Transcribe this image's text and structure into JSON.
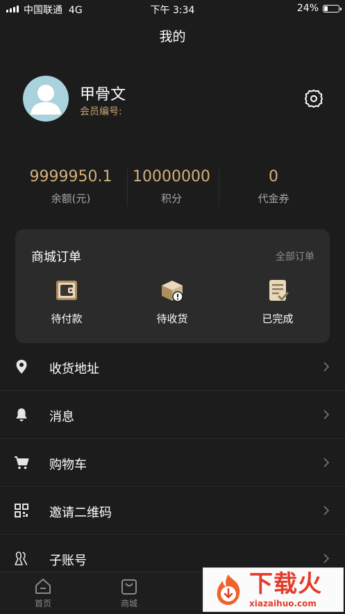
{
  "status_bar": {
    "carrier": "中国联通",
    "network": "4G",
    "time": "下午 3:34",
    "battery": "24%"
  },
  "header": {
    "title": "我的"
  },
  "profile": {
    "name": "甲骨文",
    "member_label": "会员编号:"
  },
  "stats": [
    {
      "value": "9999950.1",
      "label": "余额(元)"
    },
    {
      "value": "10000000",
      "label": "积分"
    },
    {
      "value": "0",
      "label": "代金券"
    }
  ],
  "orders": {
    "title": "商城订单",
    "view_all": "全部订单",
    "items": [
      {
        "label": "待付款",
        "icon": "wallet-icon"
      },
      {
        "label": "待收货",
        "icon": "package-icon"
      },
      {
        "label": "已完成",
        "icon": "completed-document-icon"
      }
    ]
  },
  "menu": [
    {
      "label": "收货地址",
      "icon": "location-pin-icon"
    },
    {
      "label": "消息",
      "icon": "bell-icon"
    },
    {
      "label": "购物车",
      "icon": "cart-icon"
    },
    {
      "label": "邀请二维码",
      "icon": "qr-code-icon"
    },
    {
      "label": "子账号",
      "icon": "users-icon"
    }
  ],
  "tabbar": [
    {
      "label": "首页",
      "icon": "home-icon"
    },
    {
      "label": "商城",
      "icon": "shopping-bag-icon"
    }
  ],
  "watermark": {
    "title": "下载火",
    "subtitle": "xiazaihuo.com"
  },
  "colors": {
    "background": "#1c1c1c",
    "card": "#2b2b2b",
    "gold": "#d4b07c",
    "member_text": "#c7a470",
    "avatar_bg": "#a9d2dd"
  }
}
